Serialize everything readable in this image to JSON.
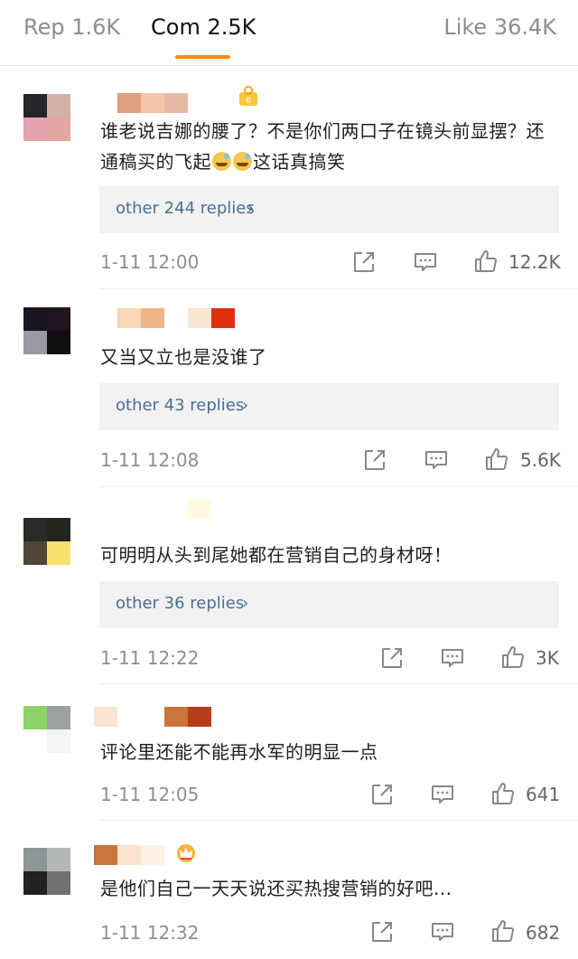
{
  "tabs": {
    "repost": "Rep 1.6K",
    "comments": "Com 2.5K",
    "likes": "Like 36.4K"
  },
  "colors": {
    "accent": "#ff8a00",
    "reply_link": "#4a6f93"
  },
  "comments": [
    {
      "text_part1": "谁老说吉娜的腰了？不是你们两口子在镜头前显摆？还通稿买的飞起",
      "text_part2": "这话真搞笑",
      "emoji": "sweat-smile-emoji",
      "replies": "other 244 replies",
      "time": "1-11 12:00",
      "likes": "12.2K",
      "badge": "fan-badge-icon"
    },
    {
      "text": "又当又立也是没谁了",
      "replies": "other 43 replies",
      "time": "1-11 12:08",
      "likes": "5.6K"
    },
    {
      "text": "可明明从头到尾她都在营销自己的身材呀！",
      "replies": "other 36 replies",
      "time": "1-11 12:22",
      "likes": "3K"
    },
    {
      "text": "评论里还能不能再水军的明显一点",
      "time": "1-11 12:05",
      "likes": "641"
    },
    {
      "text": "是他们自己一天天说还买热搜营销的好吧...",
      "time": "1-11 12:32",
      "likes": "682",
      "badge": "crown-badge-icon"
    }
  ],
  "chevron": "›"
}
